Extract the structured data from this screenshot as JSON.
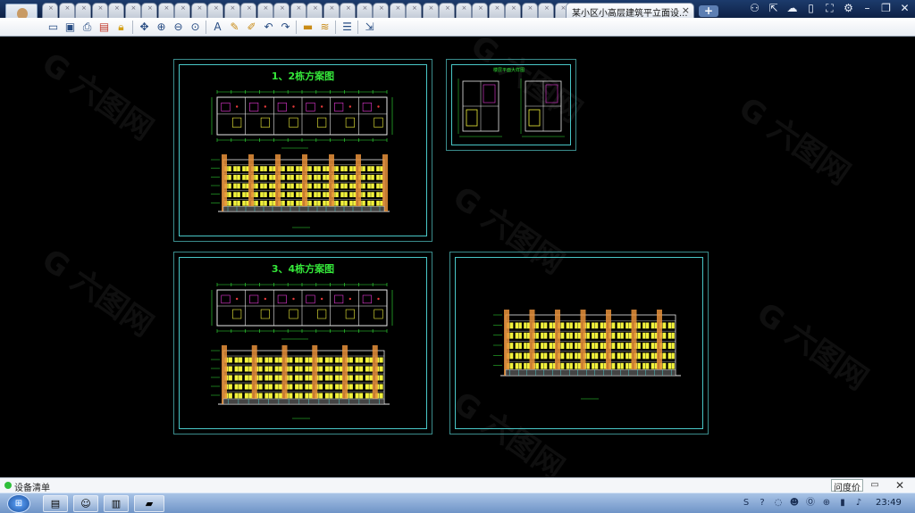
{
  "titlebar": {
    "document_tab_label": "某小区小高层建筑平立面设...",
    "document_tab_close": "×",
    "new_tab_label": "+"
  },
  "icons": {
    "window_controls": [
      "people-icon",
      "share-icon",
      "cloud-icon",
      "phone-icon",
      "fullscreen-icon",
      "gear-icon",
      "minimize-icon",
      "restore-icon",
      "close-icon"
    ],
    "toolbar": [
      "open-icon",
      "save-icon",
      "print-icon",
      "pdf-icon",
      "lock-icon",
      "move-icon",
      "zoom-in-icon",
      "zoom-out-icon",
      "zoom-window-icon",
      "text-icon",
      "pen-icon",
      "highlight-icon",
      "undo-icon",
      "redo-icon",
      "measure-icon",
      "dimension-icon",
      "layers-icon",
      "export-icon"
    ]
  },
  "drawing": {
    "sheet1_title": "1、2栋方案图",
    "sheet3_title": "3、4栋方案图",
    "sheet2_title": "楼层平面大样图",
    "colors": {
      "green": "#35e83a",
      "cyan": "#49c7c7",
      "yellow": "#f2f23a",
      "magenta": "#e83ad9",
      "red": "#e83a3a",
      "orange": "#e8903a",
      "white": "#e8e8e8"
    }
  },
  "statusbar": {
    "status_text": "设备清单",
    "ask_label": "问度价"
  },
  "taskbar": {
    "start_label": "⊞",
    "clock": "23:49"
  }
}
